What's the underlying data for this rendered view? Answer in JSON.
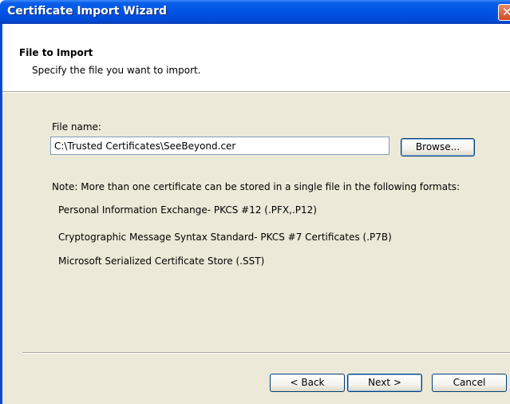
{
  "window": {
    "title": "Certificate Import Wizard",
    "close_glyph": "✕"
  },
  "header": {
    "title": "File to Import",
    "subtitle": "Specify the file you want to import."
  },
  "file": {
    "label": "File name:",
    "value": "C:\\Trusted Certificates\\SeeBeyond.cer",
    "browse_label": "Browse..."
  },
  "note": {
    "text": "Note:  More than one certificate can be stored in a single file in the following formats:",
    "formats": [
      "Personal Information Exchange- PKCS #12 (.PFX,.P12)",
      "Cryptographic Message Syntax Standard- PKCS #7 Certificates (.P7B)",
      "Microsoft Serialized Certificate Store (.SST)"
    ]
  },
  "footer": {
    "back_label": "< Back",
    "next_label": "Next >",
    "cancel_label": "Cancel"
  }
}
